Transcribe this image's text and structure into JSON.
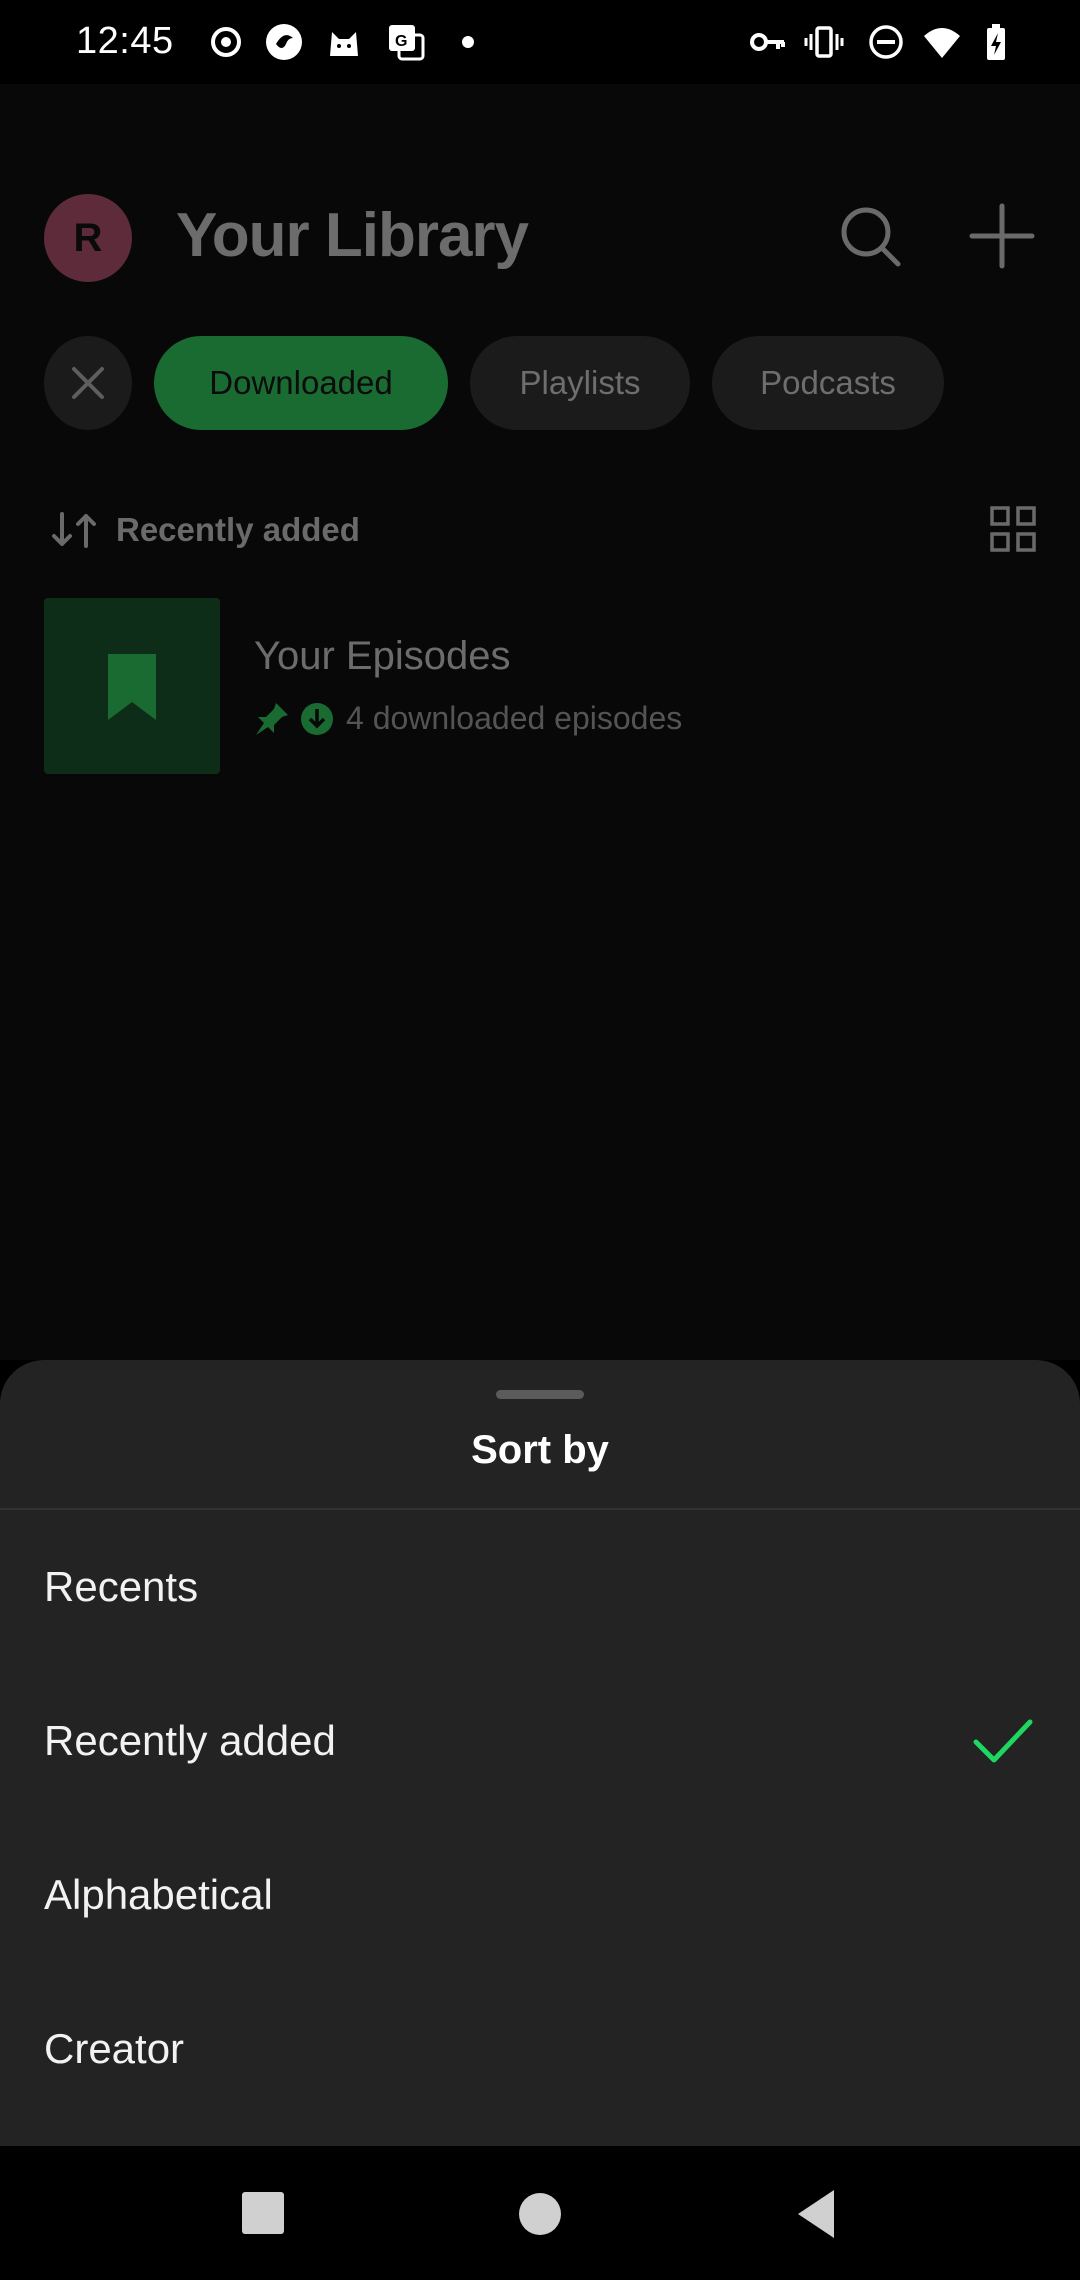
{
  "status_bar": {
    "time": "12:45",
    "left_icons": [
      "record-icon",
      "app-icon",
      "cat-icon",
      "translate-icon",
      "dot-icon"
    ],
    "right_icons": [
      "vpn-key-icon",
      "vibrate-icon",
      "do-not-disturb-icon",
      "wifi-icon",
      "battery-charging-icon"
    ]
  },
  "header": {
    "avatar_initial": "R",
    "title": "Your Library",
    "search_icon": "search-icon",
    "add_icon": "plus-icon"
  },
  "filters": {
    "chips": [
      {
        "label": "Downloaded",
        "active": true
      },
      {
        "label": "Playlists",
        "active": false
      },
      {
        "label": "Podcasts",
        "active": false
      }
    ]
  },
  "sort_bar": {
    "label": "Recently added",
    "view_icon": "grid-view-icon"
  },
  "library_items": [
    {
      "title": "Your Episodes",
      "subtitle": "4 downloaded episodes",
      "pinned": true,
      "downloaded": true
    }
  ],
  "sort_sheet": {
    "title": "Sort by",
    "options": [
      {
        "label": "Recents",
        "selected": false
      },
      {
        "label": "Recently added",
        "selected": true
      },
      {
        "label": "Alphabetical",
        "selected": false
      },
      {
        "label": "Creator",
        "selected": false
      }
    ]
  },
  "colors": {
    "accent": "#1ed760",
    "sheet_background": "#232323",
    "avatar": "#5e2b3b"
  },
  "nav_bar": {
    "buttons": [
      "recents-square-icon",
      "home-circle-icon",
      "back-triangle-icon"
    ]
  }
}
